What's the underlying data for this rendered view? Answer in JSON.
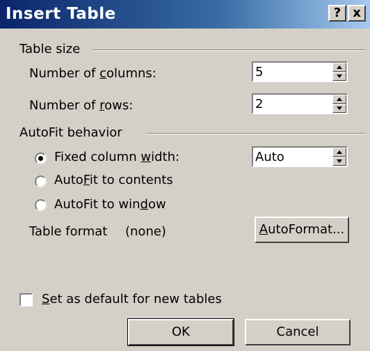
{
  "window": {
    "title": "Insert Table",
    "help_label": "?",
    "close_label": "x"
  },
  "table_size": {
    "legend": "Table size",
    "columns_label_pre": "Number of ",
    "columns_label_key": "c",
    "columns_label_post": "olumns:",
    "columns_value": "5",
    "rows_label_pre": "Number of ",
    "rows_label_key": "r",
    "rows_label_post": "ows:",
    "rows_value": "2"
  },
  "autofit": {
    "legend": "AutoFit behavior",
    "fixed_label_pre": "Fixed column ",
    "fixed_label_key": "w",
    "fixed_label_post": "idth:",
    "fixed_value": "Auto",
    "contents_label_pre": "Auto",
    "contents_label_key": "F",
    "contents_label_post": "it to contents",
    "window_label_pre": "AutoFit to win",
    "window_label_key": "d",
    "window_label_post": "ow",
    "selected": "fixed"
  },
  "table_format": {
    "label": "Table format",
    "value": "(none)"
  },
  "autoformat_button": {
    "key": "A",
    "rest": "utoFormat..."
  },
  "default_checkbox": {
    "key": "S",
    "rest": "et as default for new tables",
    "checked": false
  },
  "ok_button": "OK",
  "cancel_button": "Cancel"
}
